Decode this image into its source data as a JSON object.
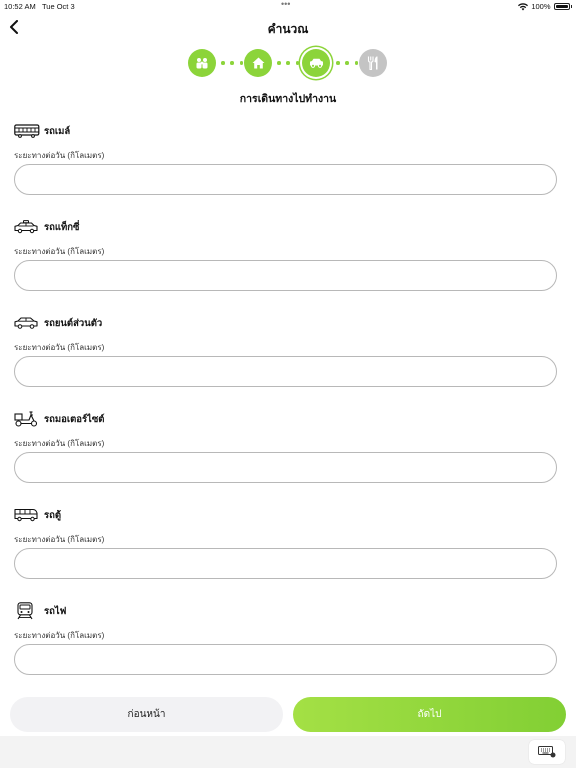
{
  "status": {
    "time": "10:52 AM",
    "date": "Tue Oct 3",
    "battery": "100%"
  },
  "header": {
    "title": "คำนวณ"
  },
  "stepper": {
    "steps": [
      {
        "icon": "people-icon",
        "state": "done"
      },
      {
        "icon": "home-icon",
        "state": "done"
      },
      {
        "icon": "car-icon",
        "state": "active"
      },
      {
        "icon": "utensils-icon",
        "state": "pending"
      }
    ],
    "colors": {
      "active": "#8cd43a",
      "pending": "#c4c4c4"
    }
  },
  "section_title": "การเดินทางไปทำงาน",
  "fields": [
    {
      "icon": "bus-icon",
      "title": "รถเมล์",
      "label": "ระยะทางต่อวัน (กิโลเมตร)",
      "value": ""
    },
    {
      "icon": "taxi-icon",
      "title": "รถแท็กซี่",
      "label": "ระยะทางต่อวัน (กิโลเมตร)",
      "value": ""
    },
    {
      "icon": "car-icon",
      "title": "รถยนต์ส่วนตัว",
      "label": "ระยะทางต่อวัน (กิโลเมตร)",
      "value": ""
    },
    {
      "icon": "motorcycle-icon",
      "title": "รถมอเตอร์ไซต์",
      "label": "ระยะทางต่อวัน (กิโลเมตร)",
      "value": ""
    },
    {
      "icon": "van-icon",
      "title": "รถตู้",
      "label": "ระยะทางต่อวัน (กิโลเมตร)",
      "value": ""
    },
    {
      "icon": "train-icon",
      "title": "รถไฟ",
      "label": "ระยะทางต่อวัน (กิโลเมตร)",
      "value": ""
    }
  ],
  "buttons": {
    "prev": "ก่อนหน้า",
    "next": "ถัดไป"
  },
  "accent_color": "#8cd43a"
}
